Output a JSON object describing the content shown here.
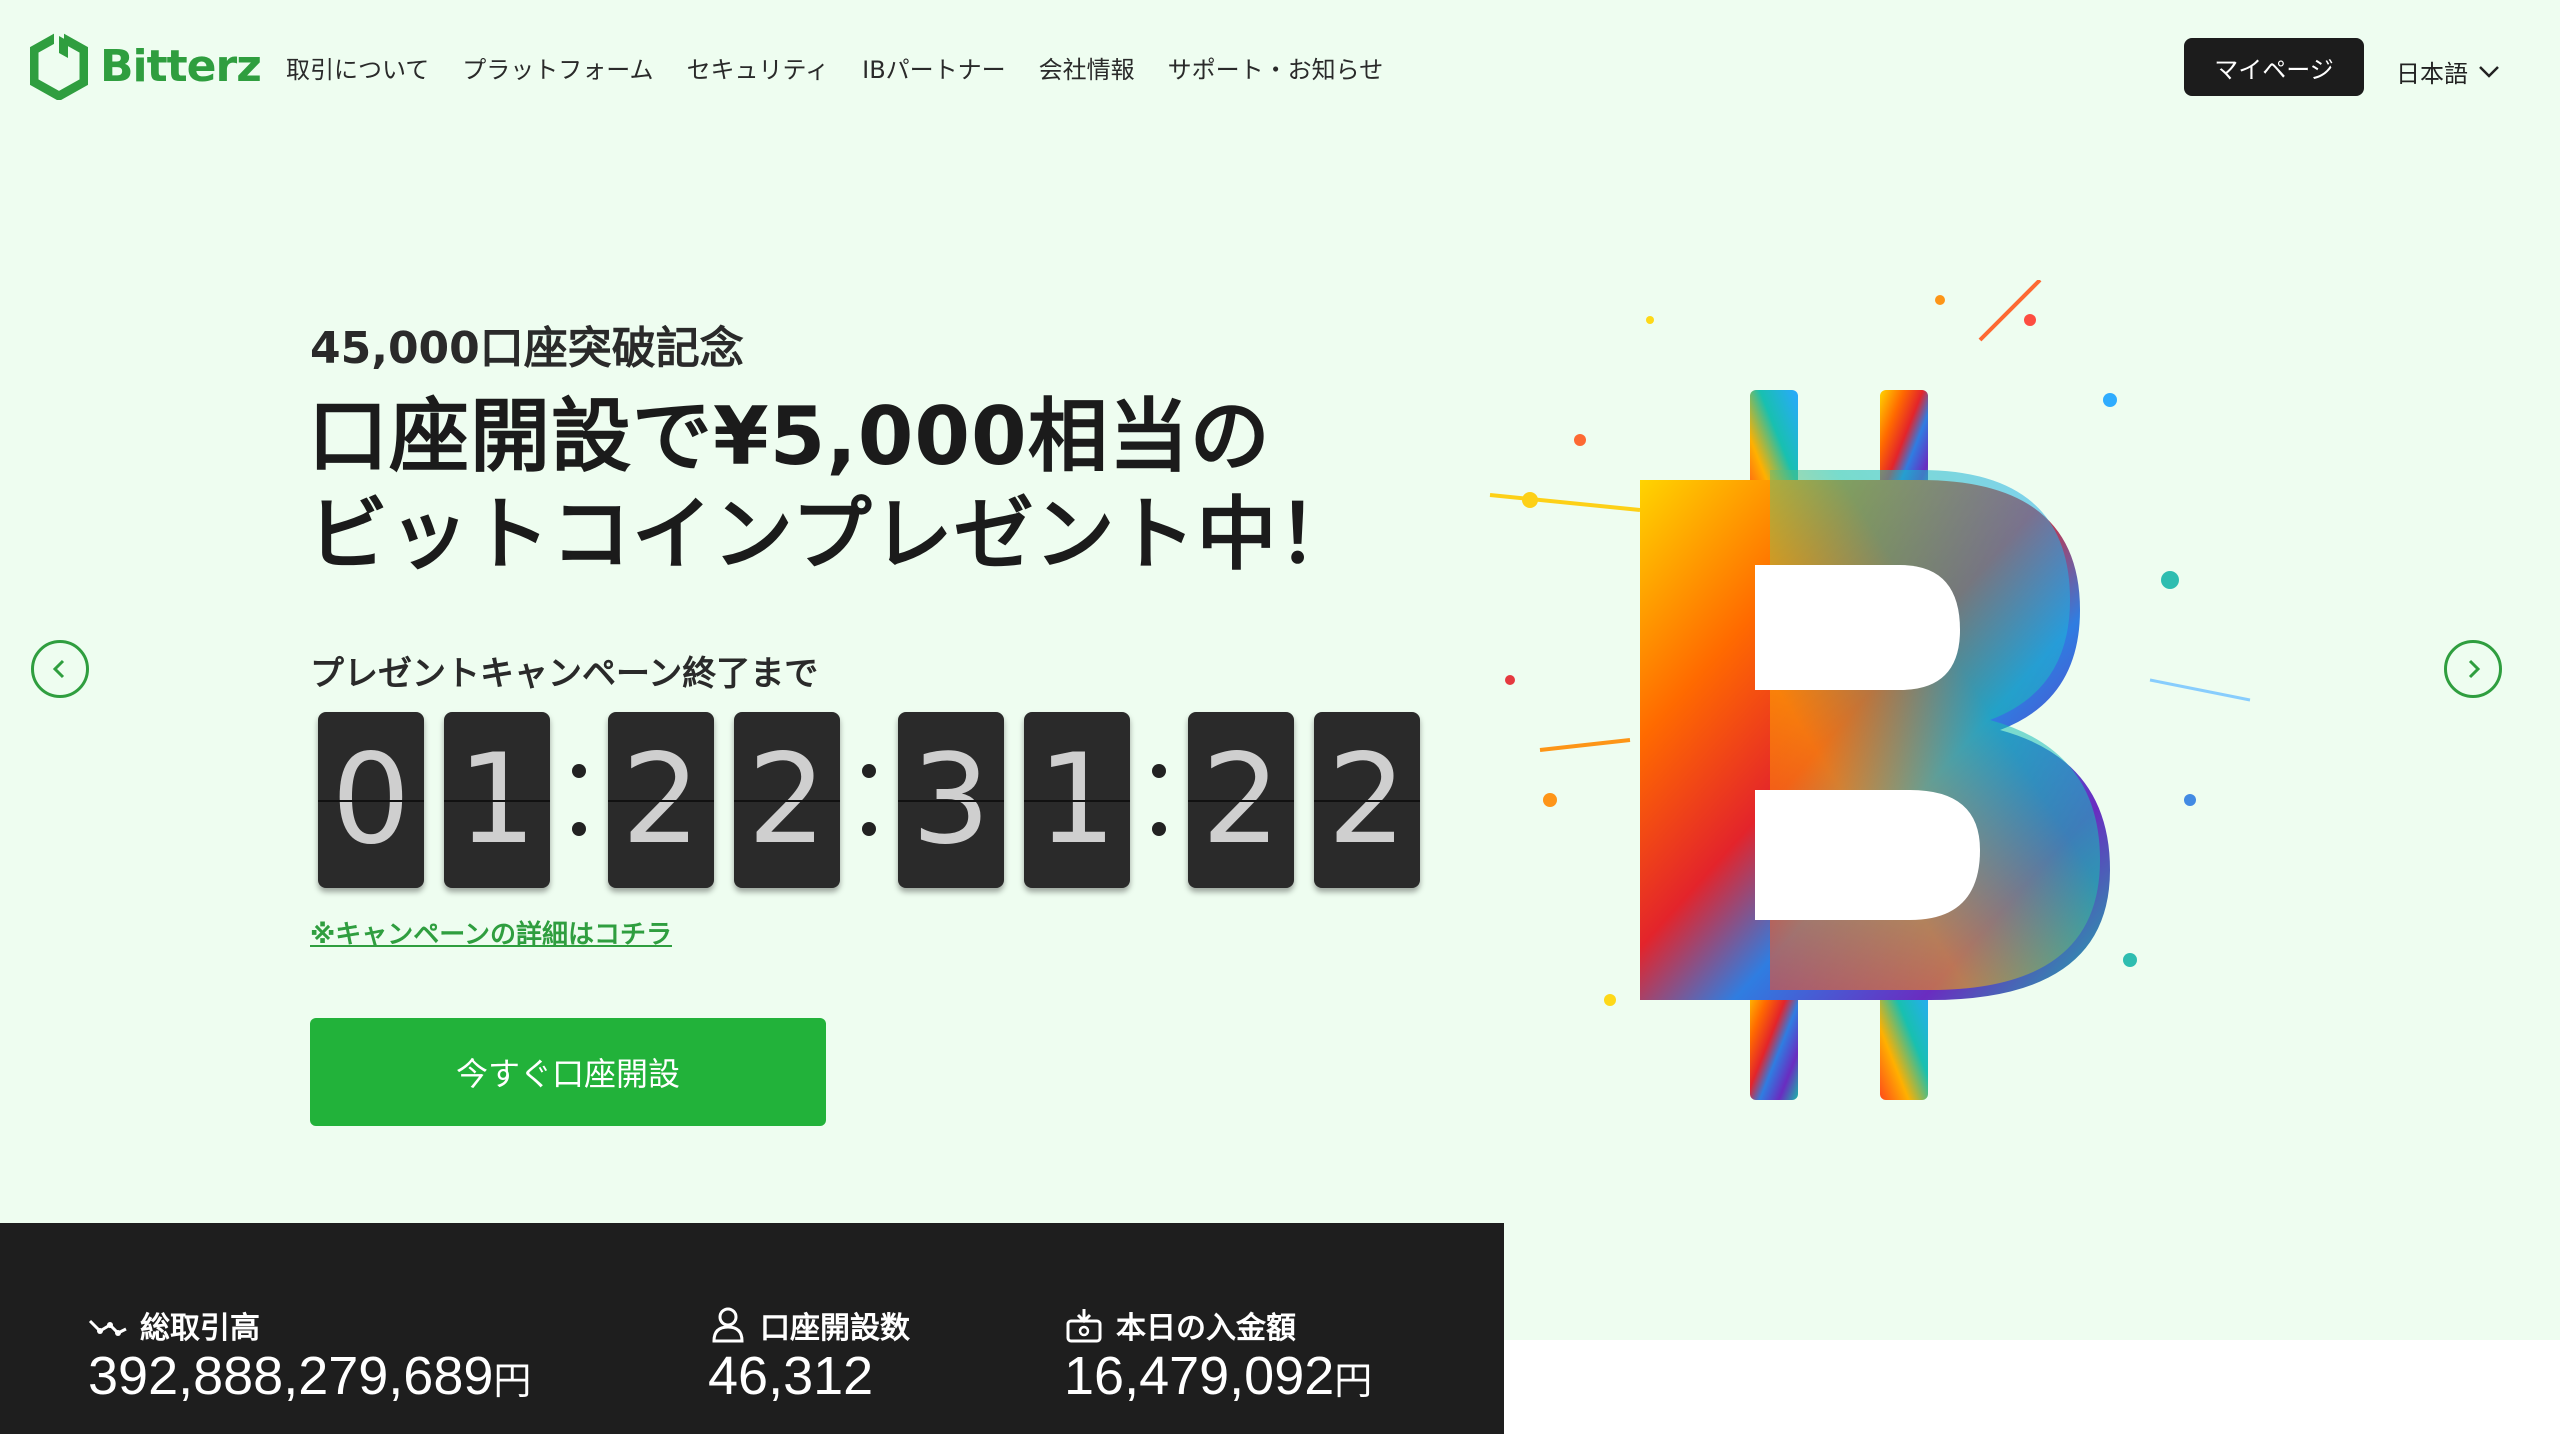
{
  "brand": {
    "name": "Bitterz",
    "color": "#2f9e3f"
  },
  "nav": {
    "items": [
      {
        "label": "取引について"
      },
      {
        "label": "プラットフォーム"
      },
      {
        "label": "セキュリティ"
      },
      {
        "label": "IBパートナー"
      },
      {
        "label": "会社情報"
      },
      {
        "label": "サポート・お知らせ"
      }
    ],
    "mypage_label": "マイページ",
    "language": "日本語"
  },
  "hero": {
    "subtitle": "45,000口座突破記念",
    "headline_line1": "口座開設で¥5,000相当の",
    "headline_line2": "ビットコインプレゼント中！",
    "countdown_label": "プレゼントキャンペーン終了まで",
    "countdown": {
      "d1": "0",
      "d2": "1",
      "d3": "2",
      "d4": "2",
      "d5": "3",
      "d6": "1",
      "d7": "2",
      "d8": "2"
    },
    "campaign_link": "※キャンペーンの詳細はコチラ",
    "cta_label": "今すぐ口座開設",
    "cta_color": "#22b23a"
  },
  "stats": {
    "trading": {
      "label": "総取引高",
      "value": "392,888,279,689",
      "unit": "円",
      "icon": "chart-line-icon"
    },
    "accounts": {
      "label": "口座開設数",
      "value": "46,312",
      "icon": "user-icon"
    },
    "deposit": {
      "label": "本日の入金額",
      "value": "16,479,092",
      "unit": "円",
      "icon": "deposit-icon"
    }
  }
}
